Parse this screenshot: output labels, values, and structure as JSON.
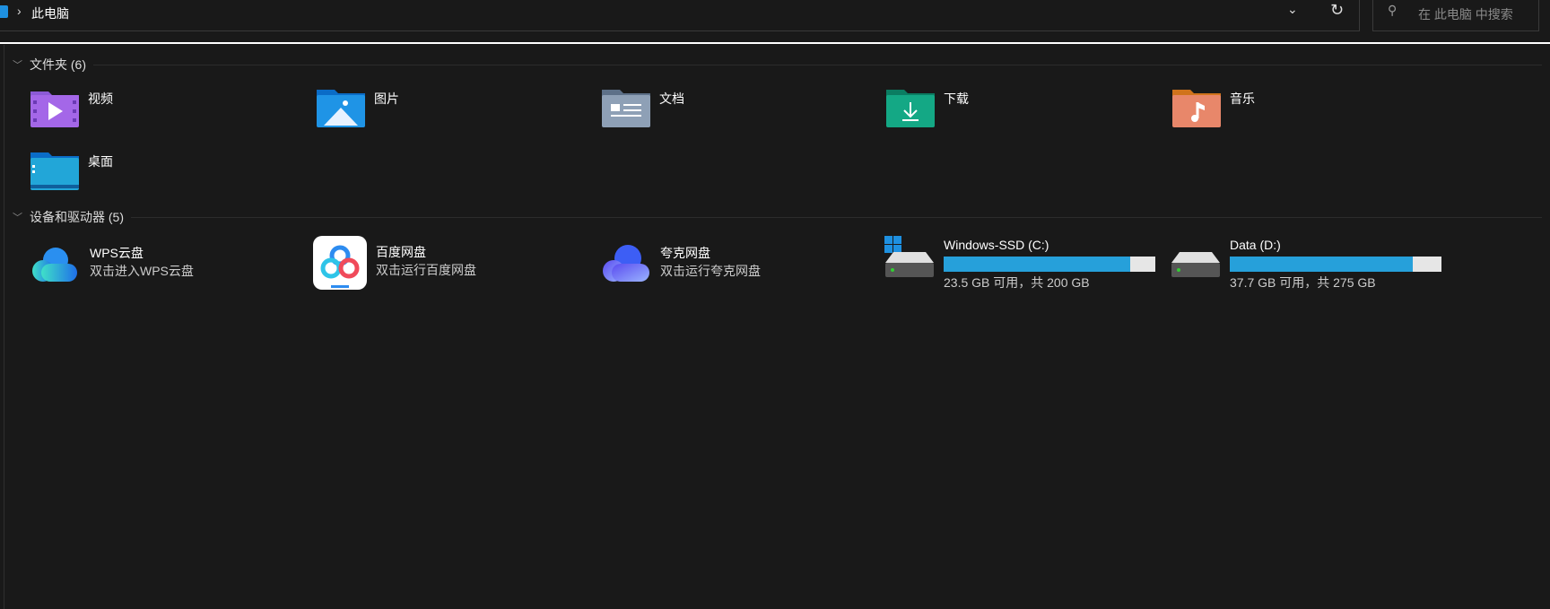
{
  "address": {
    "current": "此电脑"
  },
  "search": {
    "placeholder": "在 此电脑 中搜索"
  },
  "groups": [
    {
      "title": "文件夹 (6)",
      "items": [
        {
          "label": "视频",
          "icon": "video-folder-icon"
        },
        {
          "label": "图片",
          "icon": "pictures-folder-icon"
        },
        {
          "label": "文档",
          "icon": "documents-folder-icon"
        },
        {
          "label": "下载",
          "icon": "downloads-folder-icon"
        },
        {
          "label": "音乐",
          "icon": "music-folder-icon"
        },
        {
          "label": "桌面",
          "icon": "desktop-folder-icon"
        }
      ]
    },
    {
      "title": "设备和驱动器 (5)",
      "items": [
        {
          "label": "WPS云盘",
          "sub": "双击进入WPS云盘"
        },
        {
          "label": "百度网盘",
          "sub": "双击运行百度网盘"
        },
        {
          "label": "夸克网盘",
          "sub": "双击运行夸克网盘"
        },
        {
          "label": "Windows-SSD (C:)",
          "sub": "23.5 GB 可用，共 200 GB",
          "used_fraction": 0.8825
        },
        {
          "label": "Data (D:)",
          "sub": "37.7 GB 可用，共 275 GB",
          "used_fraction": 0.863
        }
      ]
    }
  ],
  "colors": {
    "accent": "#26a0da",
    "background": "#191919"
  }
}
